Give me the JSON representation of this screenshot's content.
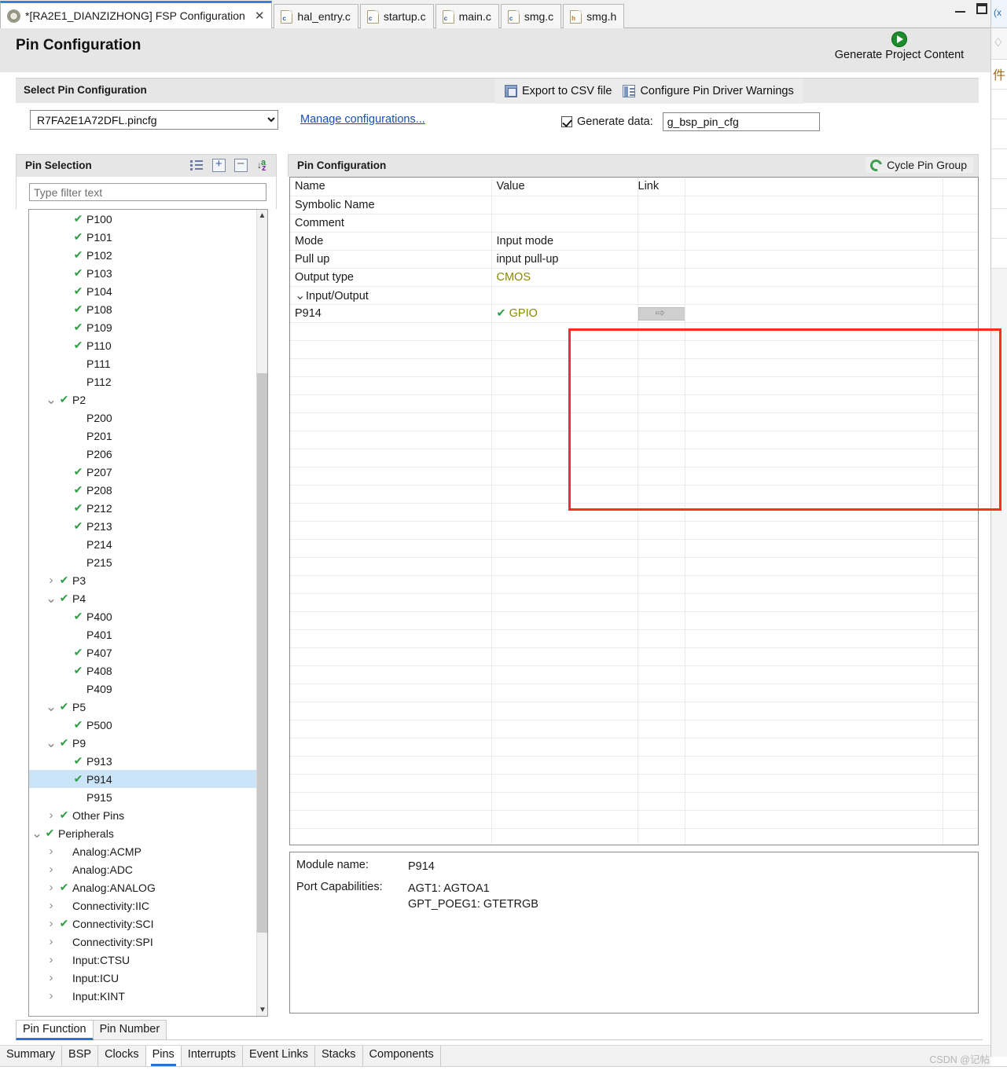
{
  "window": {
    "minimize_label": "minimize",
    "restore_label": "restore"
  },
  "editor_tabs": [
    {
      "label": "*[RA2E1_DIANZIZHONG] FSP Configuration",
      "icon": "gear-icon",
      "active": true,
      "closable": true
    },
    {
      "label": "hal_entry.c",
      "icon": "c-file-icon",
      "active": false,
      "closable": false
    },
    {
      "label": "startup.c",
      "icon": "c-file-icon",
      "active": false,
      "closable": false
    },
    {
      "label": "main.c",
      "icon": "c-file-icon",
      "active": false,
      "closable": false
    },
    {
      "label": "smg.c",
      "icon": "c-file-icon",
      "active": false,
      "closable": false
    },
    {
      "label": "smg.h",
      "icon": "h-file-icon",
      "active": false,
      "closable": false
    }
  ],
  "header": {
    "title": "Pin Configuration",
    "generate_project_content": "Generate Project Content"
  },
  "select_pin_configuration": {
    "title": "Select Pin Configuration",
    "export_csv_label": "Export to CSV file",
    "configure_warnings_label": "Configure Pin Driver Warnings",
    "pincfg_selected": "R7FA2E1A72DFL.pincfg",
    "pincfg_options": [
      "R7FA2E1A72DFL.pincfg"
    ],
    "manage_configurations_label": "Manage configurations...",
    "generate_data_label": "Generate data:",
    "generate_data_checked": true,
    "generate_data_value": "g_bsp_pin_cfg"
  },
  "pin_selection": {
    "title": "Pin Selection",
    "icons": [
      "list-icon",
      "expand-all-icon",
      "collapse-all-icon",
      "sort-az-icon"
    ],
    "filter_placeholder": "Type filter text",
    "filter_value": "",
    "tree": [
      {
        "label": "P100",
        "indent": 2,
        "checked": true,
        "twisty": ""
      },
      {
        "label": "P101",
        "indent": 2,
        "checked": true,
        "twisty": ""
      },
      {
        "label": "P102",
        "indent": 2,
        "checked": true,
        "twisty": ""
      },
      {
        "label": "P103",
        "indent": 2,
        "checked": true,
        "twisty": ""
      },
      {
        "label": "P104",
        "indent": 2,
        "checked": true,
        "twisty": ""
      },
      {
        "label": "P108",
        "indent": 2,
        "checked": true,
        "twisty": ""
      },
      {
        "label": "P109",
        "indent": 2,
        "checked": true,
        "twisty": ""
      },
      {
        "label": "P110",
        "indent": 2,
        "checked": true,
        "twisty": ""
      },
      {
        "label": "P111",
        "indent": 2,
        "checked": false,
        "twisty": ""
      },
      {
        "label": "P112",
        "indent": 2,
        "checked": false,
        "twisty": ""
      },
      {
        "label": "P2",
        "indent": 1,
        "checked": true,
        "twisty": "expanded"
      },
      {
        "label": "P200",
        "indent": 2,
        "checked": false,
        "twisty": ""
      },
      {
        "label": "P201",
        "indent": 2,
        "checked": false,
        "twisty": ""
      },
      {
        "label": "P206",
        "indent": 2,
        "checked": false,
        "twisty": ""
      },
      {
        "label": "P207",
        "indent": 2,
        "checked": true,
        "twisty": ""
      },
      {
        "label": "P208",
        "indent": 2,
        "checked": true,
        "twisty": ""
      },
      {
        "label": "P212",
        "indent": 2,
        "checked": true,
        "twisty": ""
      },
      {
        "label": "P213",
        "indent": 2,
        "checked": true,
        "twisty": ""
      },
      {
        "label": "P214",
        "indent": 2,
        "checked": false,
        "twisty": ""
      },
      {
        "label": "P215",
        "indent": 2,
        "checked": false,
        "twisty": ""
      },
      {
        "label": "P3",
        "indent": 1,
        "checked": true,
        "twisty": "collapsed"
      },
      {
        "label": "P4",
        "indent": 1,
        "checked": true,
        "twisty": "expanded"
      },
      {
        "label": "P400",
        "indent": 2,
        "checked": true,
        "twisty": ""
      },
      {
        "label": "P401",
        "indent": 2,
        "checked": false,
        "twisty": ""
      },
      {
        "label": "P407",
        "indent": 2,
        "checked": true,
        "twisty": ""
      },
      {
        "label": "P408",
        "indent": 2,
        "checked": true,
        "twisty": ""
      },
      {
        "label": "P409",
        "indent": 2,
        "checked": false,
        "twisty": ""
      },
      {
        "label": "P5",
        "indent": 1,
        "checked": true,
        "twisty": "expanded"
      },
      {
        "label": "P500",
        "indent": 2,
        "checked": true,
        "twisty": ""
      },
      {
        "label": "P9",
        "indent": 1,
        "checked": true,
        "twisty": "expanded"
      },
      {
        "label": "P913",
        "indent": 2,
        "checked": true,
        "twisty": ""
      },
      {
        "label": "P914",
        "indent": 2,
        "checked": true,
        "twisty": "",
        "selected": true
      },
      {
        "label": "P915",
        "indent": 2,
        "checked": false,
        "twisty": ""
      },
      {
        "label": "Other Pins",
        "indent": 1,
        "checked": true,
        "twisty": "collapsed"
      },
      {
        "label": "Peripherals",
        "indent": 0,
        "checked": true,
        "twisty": "expanded"
      },
      {
        "label": "Analog:ACMP",
        "indent": 1,
        "checked": false,
        "twisty": "collapsed"
      },
      {
        "label": "Analog:ADC",
        "indent": 1,
        "checked": false,
        "twisty": "collapsed"
      },
      {
        "label": "Analog:ANALOG",
        "indent": 1,
        "checked": true,
        "twisty": "collapsed"
      },
      {
        "label": "Connectivity:IIC",
        "indent": 1,
        "checked": false,
        "twisty": "collapsed"
      },
      {
        "label": "Connectivity:SCI",
        "indent": 1,
        "checked": true,
        "twisty": "collapsed"
      },
      {
        "label": "Connectivity:SPI",
        "indent": 1,
        "checked": false,
        "twisty": "collapsed"
      },
      {
        "label": "Input:CTSU",
        "indent": 1,
        "checked": false,
        "twisty": "collapsed"
      },
      {
        "label": "Input:ICU",
        "indent": 1,
        "checked": false,
        "twisty": "collapsed"
      },
      {
        "label": "Input:KINT",
        "indent": 1,
        "checked": false,
        "twisty": "collapsed"
      }
    ]
  },
  "pin_configuration": {
    "title": "Pin Configuration",
    "cycle_pin_group_label": "Cycle Pin Group",
    "columns": [
      "Name",
      "Value",
      "Link"
    ],
    "rows": [
      {
        "name": "Symbolic Name",
        "indent": 1,
        "value": "",
        "value_style": "plain",
        "twisty": "",
        "link": false
      },
      {
        "name": "Comment",
        "indent": 1,
        "value": "",
        "value_style": "plain",
        "twisty": "",
        "link": false
      },
      {
        "name": "Mode",
        "indent": 1,
        "value": "Input mode",
        "value_style": "plain",
        "twisty": "",
        "link": false
      },
      {
        "name": "Pull up",
        "indent": 1,
        "value": "input pull-up",
        "value_style": "plain",
        "twisty": "",
        "link": false
      },
      {
        "name": "Output type",
        "indent": 1,
        "value": "CMOS",
        "value_style": "olive",
        "twisty": "",
        "link": false
      },
      {
        "name": "Input/Output",
        "indent": 0,
        "value": "",
        "value_style": "plain",
        "twisty": "expanded",
        "link": false
      },
      {
        "name": "P914",
        "indent": 2,
        "value": "GPIO",
        "value_style": "olive-check",
        "twisty": "",
        "link": true
      }
    ],
    "empty_row_count": 29
  },
  "module_info": {
    "module_name_label": "Module name:",
    "module_name_value": "P914",
    "port_capabilities_label": "Port Capabilities:",
    "port_capabilities_value": "AGT1: AGTOA1\nGPT_POEG1: GTETRGB"
  },
  "sub_tabs": [
    {
      "label": "Pin Function",
      "active": true
    },
    {
      "label": "Pin Number",
      "active": false
    }
  ],
  "main_tabs": [
    {
      "label": "Summary",
      "active": false
    },
    {
      "label": "BSP",
      "active": false
    },
    {
      "label": "Clocks",
      "active": false
    },
    {
      "label": "Pins",
      "active": true
    },
    {
      "label": "Interrupts",
      "active": false
    },
    {
      "label": "Event Links",
      "active": false
    },
    {
      "label": "Stacks",
      "active": false
    },
    {
      "label": "Components",
      "active": false
    }
  ],
  "watermark": "CSDN @记帖",
  "colors": {
    "accent_blue": "#2e6fd0",
    "check_green": "#2f9e44",
    "link_blue": "#1750b5",
    "highlight_red": "#ff2b2b",
    "selection_blue": "#cce4f7",
    "olive": "#8a8a00"
  }
}
